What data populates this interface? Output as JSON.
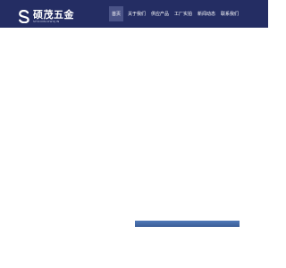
{
  "brand": {
    "name_cn": "硕茂五金",
    "name_en": "SHUOMAOWUJIN"
  },
  "nav": {
    "items": [
      {
        "label": "首页",
        "active": true
      },
      {
        "label": "关于我们",
        "active": false
      },
      {
        "label": "供应产品",
        "active": false
      },
      {
        "label": "工厂实拍",
        "active": false
      },
      {
        "label": "新闻动态",
        "active": false
      },
      {
        "label": "联系我们",
        "active": false
      }
    ]
  },
  "colors": {
    "header_bg": "#242d63",
    "nav_active_bg": "#4a5387",
    "progress_bar": "#3b5f9c"
  },
  "progress": {
    "fraction": 1.0
  }
}
